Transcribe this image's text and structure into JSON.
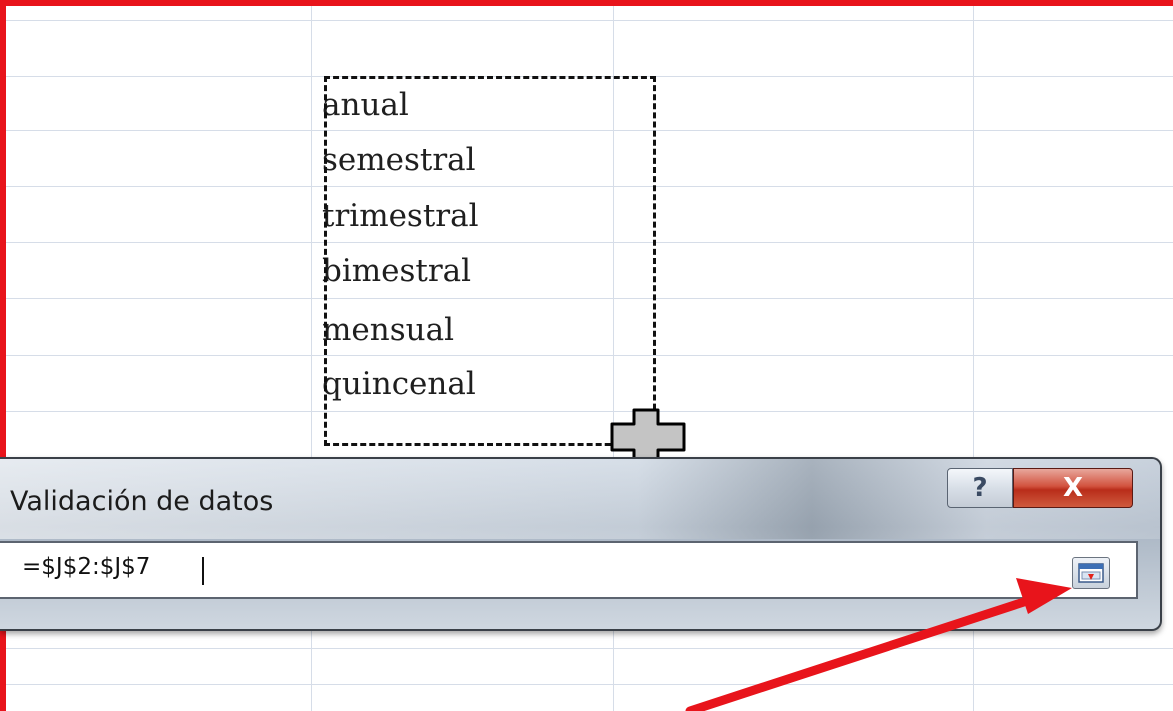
{
  "spreadsheet": {
    "list_values": [
      "anual",
      "semestral",
      "trimestral",
      "bimestral",
      "mensual",
      "quincenal"
    ]
  },
  "dialog": {
    "title": "Validación de datos",
    "help_label": "?",
    "close_label": "X",
    "range_value": "=$J$2:$J$7"
  },
  "colors": {
    "annotation_red": "#e8141b"
  },
  "icons": {
    "cursor": "move-cursor-icon",
    "collapse": "collapse-dialog-icon",
    "arrow": "red-arrow-annotation"
  }
}
